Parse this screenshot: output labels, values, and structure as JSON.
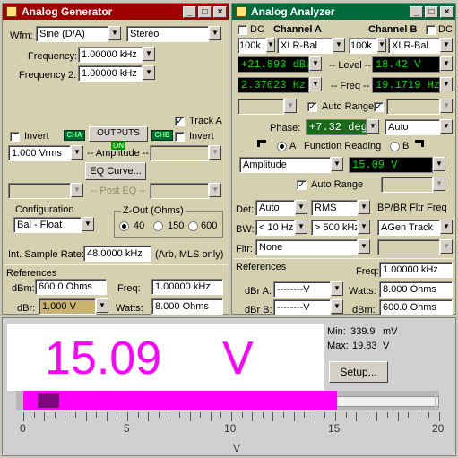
{
  "generator": {
    "title": "Analog Generator",
    "wfm_label": "Wfm:",
    "waveform": "Sine (D/A)",
    "mode": "Stereo",
    "frequency_label": "Frequency:",
    "frequency": "1.00000 kHz",
    "frequency2_label": "Frequency 2:",
    "frequency2": "1.00000 kHz",
    "track_a_label": "Track A",
    "invert_label": "Invert",
    "invert2_label": "Invert",
    "cha_tag": "CHA",
    "chb_tag": "CHB",
    "outputs_label": "OUTPUTS",
    "outputs_state": "ON",
    "amplitude_value": "1.000   Vrms",
    "amplitude_label": "-- Amplitude --",
    "eq_curve_button": "EQ Curve...",
    "post_eq_label": "-- Post EQ --",
    "configuration_label": "Configuration",
    "configuration_value": "Bal - Float",
    "zout_label": "Z-Out (Ohms)",
    "zout_options": [
      "40",
      "150",
      "600"
    ],
    "sample_rate_label": "Int. Sample Rate:",
    "sample_rate": "48.0000 kHz",
    "sample_rate_note": "(Arb, MLS only)",
    "references_label": "References",
    "dbm_label": "dBm:",
    "dbm_value": "600.0   Ohms",
    "freq_label": "Freq:",
    "freq_value": "1.00000 kHz",
    "dbr_label": "dBr:",
    "dbr_value": "1.000   V",
    "watts_label": "Watts:",
    "watts_value": "8.000   Ohms"
  },
  "analyzer": {
    "title": "Analog Analyzer",
    "dc_label": "DC",
    "channel_a_label": "Channel A",
    "channel_b_label": "Channel B",
    "dc_b_label": "DC",
    "range_a": "100k",
    "input_a": "XLR-Bal",
    "range_b": "100k",
    "input_b": "XLR-Bal",
    "level_a": "+21.893  dBu",
    "level_label": "-- Level --",
    "level_b": "18.42   V",
    "freq_a": "2.37023 Hz",
    "freq_label": "-- Freq --",
    "freq_b": "19.1719  Hz",
    "auto_range_label": "Auto Range",
    "phase_label": "Phase:",
    "phase_value": "+7.32   deg",
    "phase_mode": "Auto",
    "function_label": "Function Reading",
    "radio_a": "A",
    "radio_b": "B",
    "function_value": "Amplitude",
    "function_reading": "15.09   V",
    "auto_range2_label": "Auto Range",
    "bp_br_label": "BP/BR Fltr Freq",
    "det_label": "Det:",
    "det_value": "Auto",
    "det_mode": "RMS",
    "bw_label": "BW:",
    "bw_low": "< 10 Hz",
    "bw_high": "> 500 kHz",
    "agen_track": "AGen Track",
    "fltr_label": "Fltr:",
    "fltr_value": "None",
    "references_label": "References",
    "ref_freq_label": "Freq:",
    "ref_freq_value": "1.00000 kHz",
    "dbr_a_label": "dBr A:",
    "dbr_a_value": "--------V",
    "ref_watts_label": "Watts:",
    "ref_watts_value": "8.000   Ohms",
    "dbr_b_label": "dBr B:",
    "dbr_b_value": "--------V",
    "ref_dbm_label": "dBm:",
    "ref_dbm_value": "600.0   Ohms"
  },
  "meter": {
    "reading_value": "15.09",
    "reading_unit": "V",
    "min_label": "Min:",
    "min_value": "339.9",
    "min_unit": "mV",
    "max_label": "Max:",
    "max_value": "19.83",
    "max_unit": "V",
    "setup_button": "Setup...",
    "scale_ticks": [
      "0",
      "5",
      "10",
      "15",
      "20"
    ],
    "scale_min": 0,
    "scale_max": 20,
    "bar_value": 15.09,
    "peak_value": 19.83,
    "axis_unit": "V",
    "bar_color": "#ff00ff"
  },
  "colors": {
    "generator_title": "#a00000",
    "analyzer_title": "#006a3a",
    "reading": "#ff00ff",
    "panel": "#d4d0b0"
  }
}
